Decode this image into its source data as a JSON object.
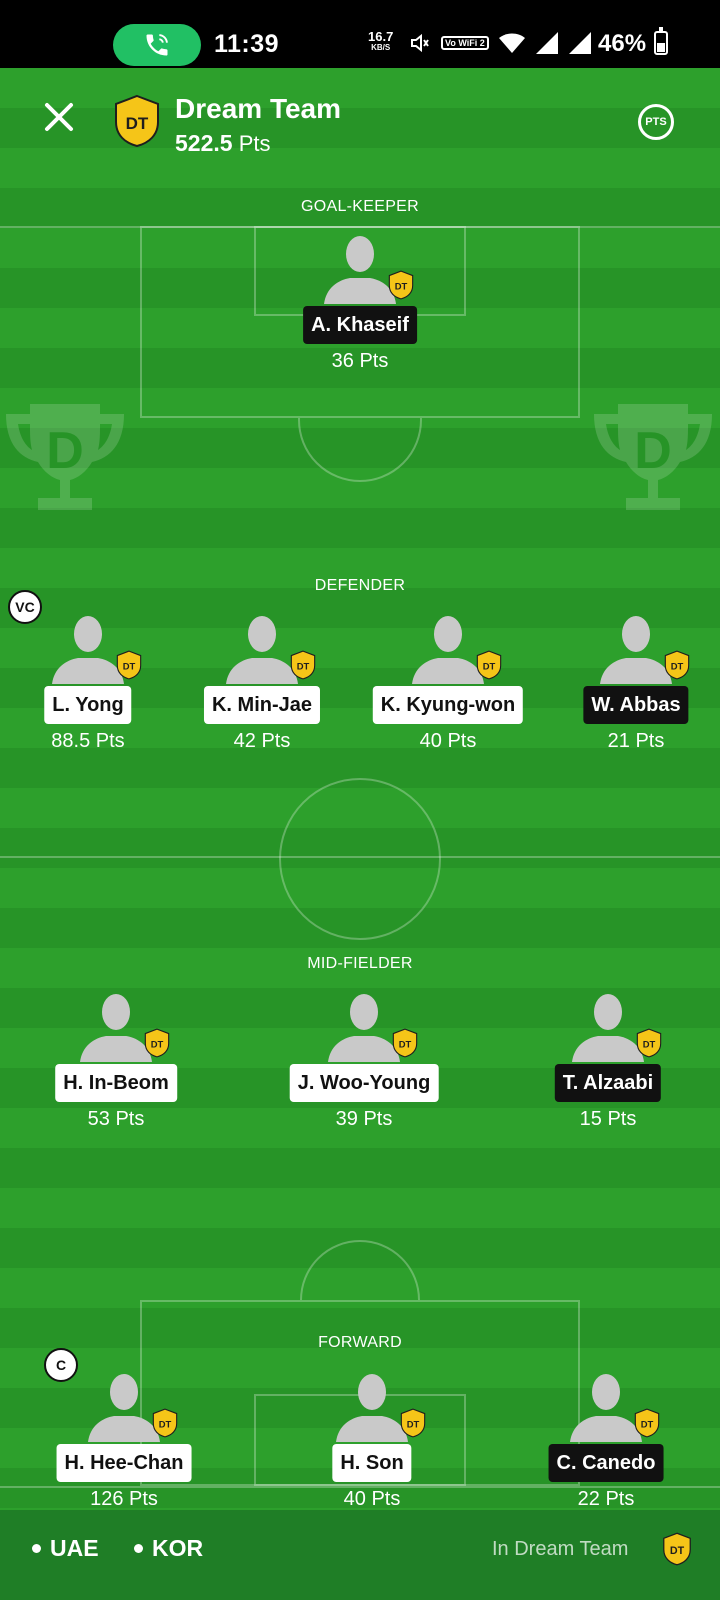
{
  "status_bar": {
    "time": "11:39",
    "net_speed": "16.7",
    "net_unit": "KB/S",
    "vowifi": "Vo WiFi 2",
    "battery": "46%",
    "battery_level": 0.46,
    "icons": [
      "phone-call-icon",
      "volume-icon",
      "wifi-icon",
      "signal-icon",
      "signal-icon",
      "battery-icon"
    ]
  },
  "header": {
    "badge_text": "DT",
    "title": "Dream Team",
    "points_value": "522.5",
    "points_unit": "Pts",
    "pts_button": "PTS"
  },
  "sections": {
    "goalkeeper": "GOAL-KEEPER",
    "defender": "DEFENDER",
    "midfielder": "MID-FIELDER",
    "forward": "FORWARD"
  },
  "players": {
    "gk": [
      {
        "name": "A. Khaseif",
        "pts": "36 Pts",
        "team": "UAE"
      }
    ],
    "def": [
      {
        "name": "L. Yong",
        "pts": "88.5 Pts",
        "team": "KOR",
        "role": "VC"
      },
      {
        "name": "K. Min-Jae",
        "pts": "42 Pts",
        "team": "KOR"
      },
      {
        "name": "K. Kyung-won",
        "pts": "40 Pts",
        "team": "KOR"
      },
      {
        "name": "W. Abbas",
        "pts": "21 Pts",
        "team": "UAE"
      }
    ],
    "mid": [
      {
        "name": "H. In-Beom",
        "pts": "53 Pts",
        "team": "KOR"
      },
      {
        "name": "J. Woo-Young",
        "pts": "39 Pts",
        "team": "KOR"
      },
      {
        "name": "T. Alzaabi",
        "pts": "15 Pts",
        "team": "UAE"
      }
    ],
    "fwd": [
      {
        "name": "H. Hee-Chan",
        "pts": "126 Pts",
        "team": "KOR",
        "role": "C"
      },
      {
        "name": "H. Son",
        "pts": "40 Pts",
        "team": "KOR"
      },
      {
        "name": "C. Canedo",
        "pts": "22 Pts",
        "team": "UAE"
      }
    ]
  },
  "dt_badge": "DT",
  "footer": {
    "team1": "UAE",
    "team2": "KOR",
    "in_dream_team": "In Dream Team",
    "badge": "DT"
  },
  "colors": {
    "pitch_light": "#2da02c",
    "pitch_dark": "#279427",
    "badge_yellow": "#f5c518",
    "call_green": "#21c064"
  }
}
